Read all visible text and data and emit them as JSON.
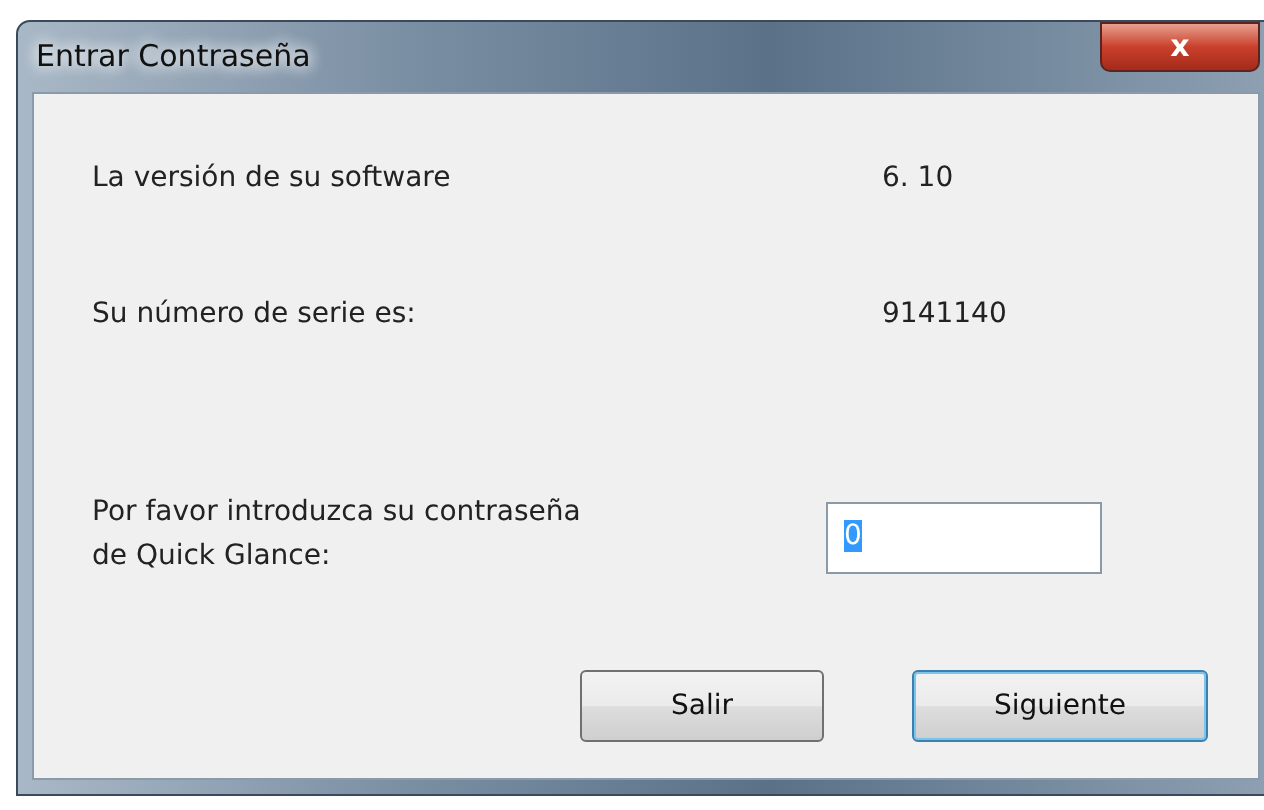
{
  "window": {
    "title": "Entrar Contraseña",
    "close": "x"
  },
  "info_rows": [
    {
      "label": "La versión de su software",
      "value": "6. 10"
    },
    {
      "label": "Su número de serie es:",
      "value": "9141140"
    }
  ],
  "password": {
    "label": "Por favor introduzca su contraseña de Quick Glance:",
    "value": "0",
    "selected": true
  },
  "buttons": [
    {
      "label": "Salir",
      "default": false
    },
    {
      "label": "Siguiente",
      "default": true
    }
  ]
}
